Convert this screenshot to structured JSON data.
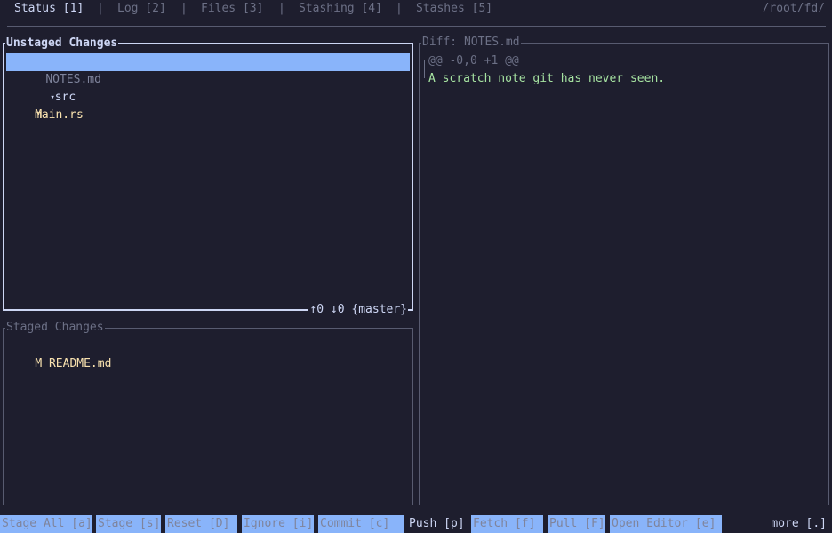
{
  "tabs": [
    {
      "label": "Status [1]",
      "active": true
    },
    {
      "label": "Log [2]",
      "active": false
    },
    {
      "label": "Files [3]",
      "active": false
    },
    {
      "label": "Stashing [4]",
      "active": false
    },
    {
      "label": "Stashes [5]",
      "active": false
    }
  ],
  "tab_separator": "|",
  "repo_path": "/root/fd/",
  "unstaged": {
    "title": "Unstaged Changes",
    "items": [
      {
        "status": "",
        "name": "NOTES.md",
        "selected": true
      },
      {
        "status": "",
        "name": "src",
        "is_dir": true,
        "arrow": "▾"
      },
      {
        "status": "M",
        "name": "main.rs"
      }
    ],
    "branch_info": "↑0 ↓0 {master}"
  },
  "staged": {
    "title": "Staged Changes",
    "items": [
      {
        "status": "M",
        "name": "README.md"
      }
    ]
  },
  "diff": {
    "title": "Diff: NOTES.md",
    "hunk_header": "@@ -0,0 +1 @@",
    "added_line": "A scratch note git has never seen."
  },
  "keybinds": [
    "Stage All [a]",
    "Stage [s]",
    "Reset [D]",
    "Ignore [i]",
    "Commit [c]",
    "Push [p]",
    "Fetch [f]",
    "Pull [F]",
    "Open Editor [e]"
  ],
  "more_label": "more [.]",
  "colors": {
    "background": "#1e1e2e",
    "selection": "#89b4fa",
    "modified": "#f9e2af",
    "added": "#a6e3a1",
    "border_focused": "#cdd6f4",
    "border_dim": "#585b70"
  }
}
